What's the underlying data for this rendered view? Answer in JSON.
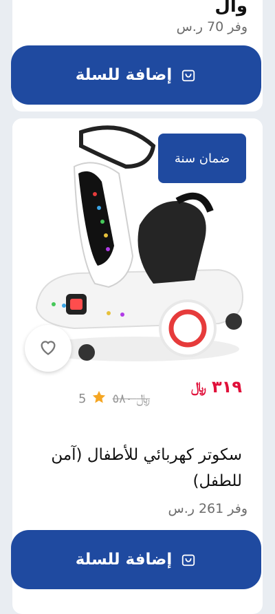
{
  "cards": [
    {
      "partial_title": "وال",
      "saving": "وفر 70 ر.س",
      "add_to_cart": "إضافة للسلة"
    },
    {
      "warranty_badge": "ضمان سنة",
      "price": "٣١٩",
      "currency_symbol": "﷼",
      "old_price": "٥٨٠",
      "rating": "5",
      "title": "سكوتر كهربائي للأطفال (آمن للطفل)",
      "saving": "وفر 261 ر.س",
      "add_to_cart": "إضافة للسلة"
    }
  ],
  "colors": {
    "primary": "#1f4aa0",
    "price": "#e0103a",
    "star": "#f5a623"
  },
  "icons": [
    "bag-icon",
    "heart-icon",
    "star-icon"
  ]
}
